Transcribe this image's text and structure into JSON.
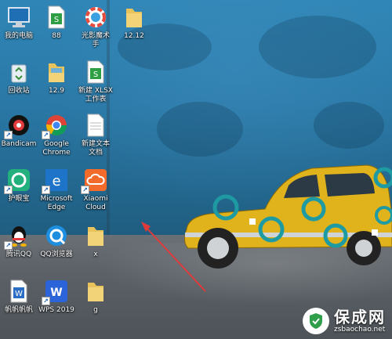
{
  "desktop": {
    "icons": [
      {
        "id": "my-computer",
        "label": "我的电脑"
      },
      {
        "id": "88",
        "label": "88"
      },
      {
        "id": "guangying",
        "label": "光影魔术\n手"
      },
      {
        "id": "1212",
        "label": "12.12"
      },
      {
        "id": "recycle",
        "label": "回收站"
      },
      {
        "id": "129",
        "label": "12.9"
      },
      {
        "id": "xlsx",
        "label": "新建 XLSX\n工作表"
      },
      {
        "id": "bandicam",
        "label": "Bandicam"
      },
      {
        "id": "chrome",
        "label": "Google\nChrome"
      },
      {
        "id": "newtxt",
        "label": "新建文本\n文档"
      },
      {
        "id": "hujinbao",
        "label": "护眼宝"
      },
      {
        "id": "edge",
        "label": "Microsoft\nEdge"
      },
      {
        "id": "xiaomi",
        "label": "Xiaomi\nCloud"
      },
      {
        "id": "qq",
        "label": "腾讯QQ"
      },
      {
        "id": "qqbrowser",
        "label": "QQ浏览器"
      },
      {
        "id": "x",
        "label": "x"
      },
      {
        "id": "fanfan",
        "label": "帆帆帆帆"
      },
      {
        "id": "wps",
        "label": "WPS 2019"
      },
      {
        "id": "g",
        "label": "g"
      }
    ]
  },
  "watermark": {
    "main": "保成网",
    "sub": "zsbaochao.net"
  },
  "colors": {
    "wall": "#2a78a6",
    "floor": "#5b6167",
    "car": "#e0b21c",
    "arrow": "#e03a3a"
  }
}
